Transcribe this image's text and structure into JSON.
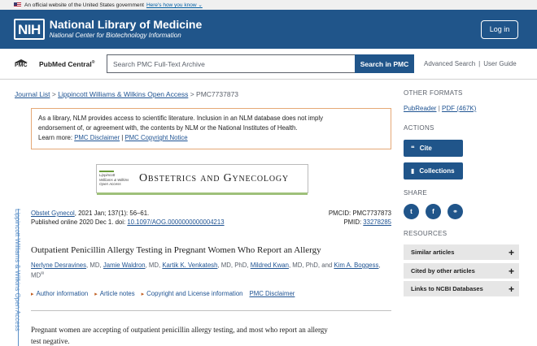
{
  "gov_banner": {
    "text": "An official website of the United States government",
    "link": "Here's how you know"
  },
  "header": {
    "logo_mark": "NIH",
    "title": "National Library of Medicine",
    "subtitle": "National Center for Biotechnology Information",
    "login_label": "Log in"
  },
  "search": {
    "brand": "PubMed Central",
    "brand_mark": "®",
    "placeholder": "Search PMC Full-Text Archive",
    "button": "Search in PMC",
    "advanced": "Advanced Search",
    "separator": "|",
    "guide": "User Guide"
  },
  "breadcrumb": {
    "journal_list": "Journal List",
    "sep": ">",
    "publisher": "Lippincott Williams & Wilkins Open Access",
    "pmc_id": "PMC7737873"
  },
  "notice": {
    "line1": "As a library, NLM provides access to scientific literature. Inclusion in an NLM database does not imply",
    "line2": "endorsement of, or agreement with, the contents by NLM or the National Institutes of Health.",
    "learn_more": "Learn more:",
    "disclaimer": "PMC Disclaimer",
    "sep": "|",
    "copyright": "PMC Copyright Notice"
  },
  "journal_banner": {
    "publisher_lines": [
      "Lippincott",
      "Williams & Wilkins",
      "Open Access"
    ],
    "title": "Obstetrics and Gynecology"
  },
  "side_label": "Lippincott Williams & Wilkins Open Access",
  "citation": {
    "journal": "Obstet Gynecol",
    "details": ", 2021 Jan; 137(1): 56–61.",
    "published": "Published online 2020 Dec 1. doi:",
    "doi": "10.1097/AOG.0000000000004213",
    "pmcid_label": "PMCID:",
    "pmcid": "PMC7737873",
    "pmid_label": "PMID:",
    "pmid": "33278285"
  },
  "article": {
    "title": "Outpatient Penicillin Allergy Testing in Pregnant Women Who Report an Allergy",
    "authors": [
      {
        "name": "Nerlyne Desravines",
        "suffix": ", MD, "
      },
      {
        "name": "Jamie Waldron",
        "suffix": ", MD, "
      },
      {
        "name": "Kartik K. Venkatesh",
        "suffix": ", MD, PhD, "
      },
      {
        "name": "Mildred Kwan",
        "suffix": ", MD, PhD, and "
      },
      {
        "name": "Kim A. Boggess",
        "suffix": ", MD"
      }
    ],
    "author_mark": "✉",
    "meta_links": [
      "Author information",
      "Article notes",
      "Copyright and License information",
      "PMC Disclaimer"
    ],
    "abstract_line1": "Pregnant women are accepting of outpatient penicillin allergy testing, and most who report an allergy",
    "abstract_line2": "test negative."
  },
  "sidebar": {
    "other_formats": "OTHER FORMATS",
    "pubreader": "PubReader",
    "sep": "|",
    "pdf": "PDF (467K)",
    "actions": "ACTIONS",
    "cite": "Cite",
    "collections": "Collections",
    "share": "SHARE",
    "share_icons": [
      "twitter-icon",
      "facebook-icon",
      "link-icon"
    ],
    "resources": "RESOURCES",
    "resource_items": [
      "Similar articles",
      "Cited by other articles",
      "Links to NCBI Databases"
    ]
  },
  "colors": {
    "header_bg": "#20558a",
    "link": "#205493",
    "notice_border": "#e5a876",
    "side_label": "#5b8fc7"
  }
}
